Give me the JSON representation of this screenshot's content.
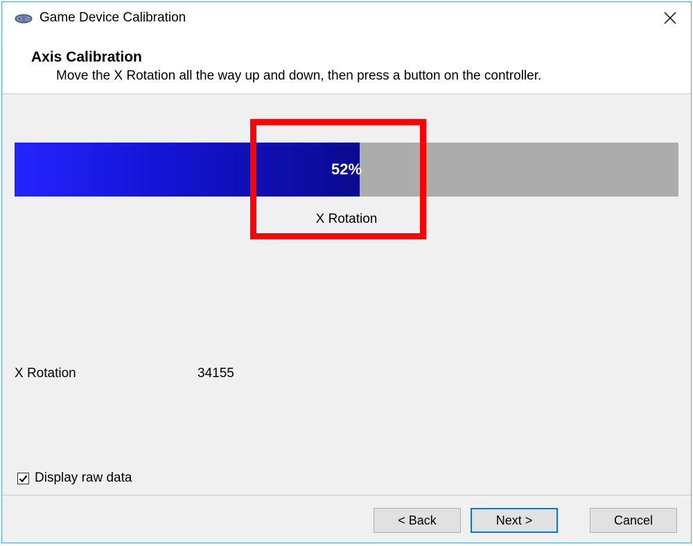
{
  "window": {
    "title": "Game Device Calibration"
  },
  "header": {
    "title": "Axis Calibration",
    "description": "Move the X Rotation all the way up and down, then press a button on the controller."
  },
  "progress": {
    "percent_label": "52%",
    "percent_value": 52,
    "axis_label": "X Rotation"
  },
  "raw": {
    "label": "X Rotation",
    "value": "34155"
  },
  "checkbox": {
    "label": "Display raw data",
    "checked": true
  },
  "buttons": {
    "back": "< Back",
    "next": "Next >",
    "cancel": "Cancel"
  },
  "colors": {
    "accent": "#0078d7",
    "highlight": "#ff0000"
  }
}
